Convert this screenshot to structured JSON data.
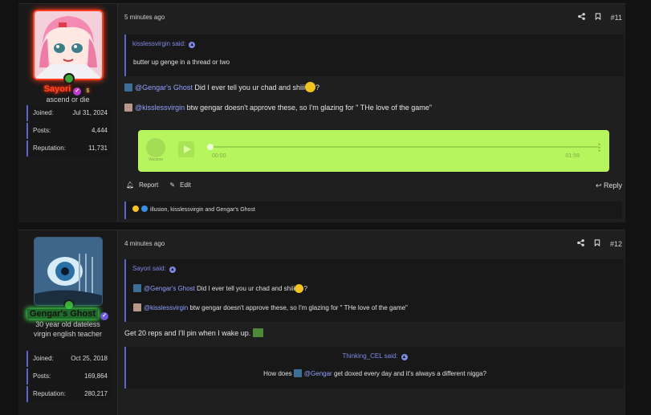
{
  "posts": [
    {
      "user": {
        "name": "Sayori",
        "title": "ascend or die",
        "stats": [
          {
            "label": "Joined:",
            "value": "Jul 31, 2024"
          },
          {
            "label": "Posts:",
            "value": "4,444"
          },
          {
            "label": "Reputation:",
            "value": "11,731"
          }
        ]
      },
      "time": "5 minutes ago",
      "number": "#11",
      "quote": {
        "author": "kisslessvirgin said:",
        "text": "butter up genge in a thread or two"
      },
      "line1": {
        "mention": "@Gengar's Ghost",
        "text": "Did I ever tell you ur chad and shiii",
        "end": "?"
      },
      "line2": {
        "mention": "@kisslessvirgin",
        "text": "btw gengar doesn't approve these, so I'm glazing for \" THe love of the game\""
      },
      "audio": {
        "brand": "Vocaroo",
        "current": "00:00",
        "duration": "01:59"
      },
      "actions": {
        "report": "Report",
        "edit": "Edit",
        "reply": "Reply"
      },
      "reactions": "illusion, kisslessvirgin and Gengar's Ghost"
    },
    {
      "user": {
        "name": "Gengar's Ghost",
        "title": "30 year old dateless virgin english teacher",
        "stats": [
          {
            "label": "Joined:",
            "value": "Oct 25, 2018"
          },
          {
            "label": "Posts:",
            "value": "169,864"
          },
          {
            "label": "Reputation:",
            "value": "280,217"
          }
        ]
      },
      "time": "4 minutes ago",
      "number": "#12",
      "quote": {
        "author": "Sayori said:",
        "line1_mention": "@Gengar's Ghost",
        "line1_text": "Did I ever tell you ur chad and shiii",
        "line1_end": "?",
        "line2_mention": "@kisslessvirgin",
        "line2_text": "btw gengar doesn't approve these, so I'm glazing for \" THe love of the game\""
      },
      "text": "Get 20 reps and I'll pin when I wake up.",
      "quote2": {
        "author": "Thinking_CEL said:",
        "pre": "How does",
        "mention": "@Gengar",
        "post": "get doxed every day and it's always a different nigga?"
      }
    }
  ]
}
